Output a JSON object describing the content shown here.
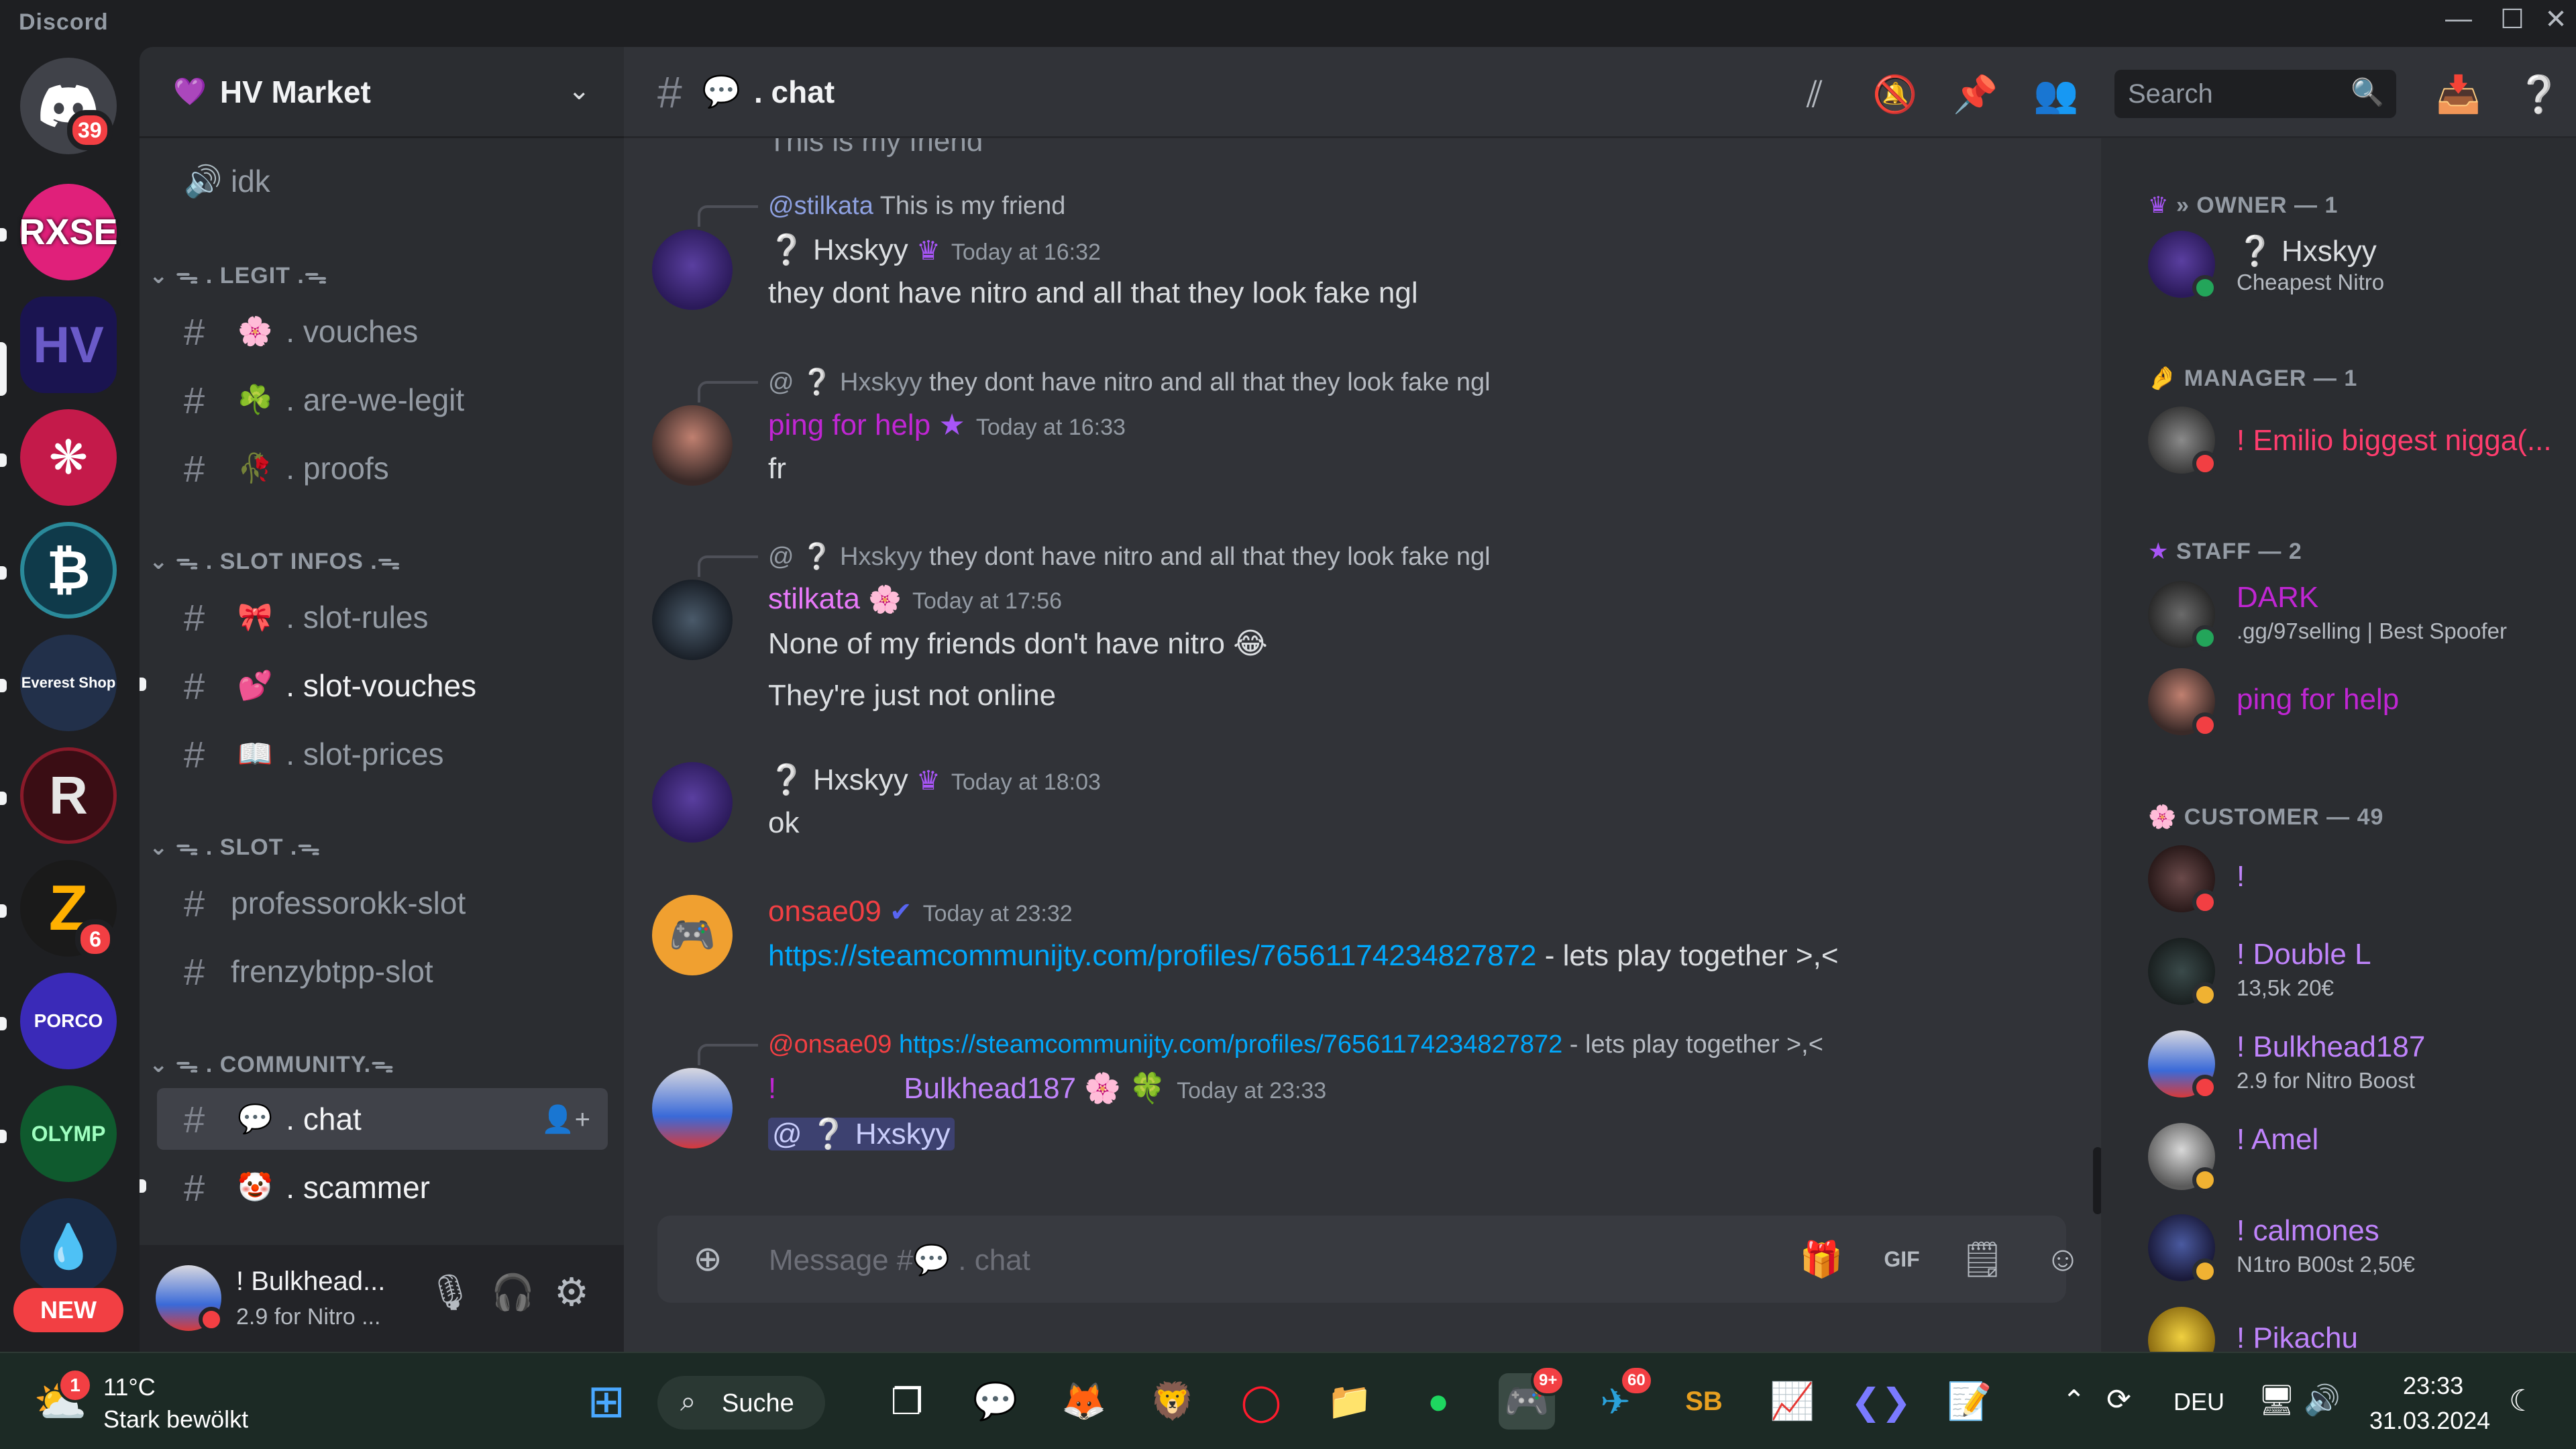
{
  "app": {
    "title": "Discord"
  },
  "window_controls": {
    "minimize": "—",
    "maximize": "☐",
    "close": "✕"
  },
  "rail": {
    "home_badge": "39",
    "servers": [
      {
        "name": "RXSE",
        "label": "RXSE",
        "color": "#e0207a"
      },
      {
        "name": "HV Market",
        "label": "HV",
        "color": "#1a1450"
      },
      {
        "name": "Service",
        "label": "❋",
        "color": "#c41a4a"
      },
      {
        "name": "Bitcoin",
        "label": "₿",
        "color": "#0f3a4a"
      },
      {
        "name": "Everest Shop",
        "label": "Everest Shop",
        "color": "#22304a"
      },
      {
        "name": "R server",
        "label": "R",
        "color": "#3a0d14"
      },
      {
        "name": "Z server",
        "label": "Z",
        "color": "#1a1a1a"
      },
      {
        "name": "Porco Exchange",
        "label": "PORCO",
        "color": "#3a2ab8"
      },
      {
        "name": "Olymp",
        "label": "OLYMP",
        "color": "#0f5a2e"
      },
      {
        "name": "Drop",
        "label": "💧",
        "color": "#1a2a44"
      }
    ],
    "z_badge": "6",
    "new_label": "NEW"
  },
  "guild": {
    "name": "HV Market",
    "icon": "💜"
  },
  "channels": {
    "voice_idk": "idk",
    "categories": [
      {
        "label": "ᯓ . LEGIT .ᯓ"
      },
      {
        "label": "ᯓ . SLOT INFOS .ᯓ"
      },
      {
        "label": "ᯓ . SLOT .ᯓ"
      },
      {
        "label": "ᯓ . COMMUNITY.ᯓ"
      }
    ],
    "items": [
      {
        "emoji": "🌸",
        "label": ". vouches"
      },
      {
        "emoji": "☘️",
        "label": ". are-we-legit"
      },
      {
        "emoji": "🥀",
        "label": ". proofs"
      },
      {
        "emoji": "🎀",
        "label": ". slot-rules"
      },
      {
        "emoji": "💕",
        "label": ". slot-vouches"
      },
      {
        "emoji": "📖",
        "label": ". slot-prices"
      },
      {
        "emoji": "",
        "label": "professorokk-slot"
      },
      {
        "emoji": "",
        "label": "frenzybtpp-slot"
      },
      {
        "emoji": "💬",
        "label": ". chat"
      },
      {
        "emoji": "🤡",
        "label": ". scammer"
      }
    ]
  },
  "user_panel": {
    "name": "! Bulkhead...",
    "status": "2.9 for Nitro ..."
  },
  "chat_header": {
    "channel_name": ". chat",
    "search_placeholder": "Search"
  },
  "messages": {
    "cut_top": "This is my friend",
    "m1": {
      "reply_name": "@stilkata",
      "reply_text": "This is my friend",
      "author": "❔ Hxskyy",
      "ts": "Today at 16:32",
      "text": "they dont have nitro and all that they look fake ngl"
    },
    "m2": {
      "reply_name": "@ ❔ Hxskyy",
      "reply_text": "they dont have nitro and all that they look fake ngl",
      "author": "ping for help",
      "ts": "Today at 16:33",
      "text": "fr"
    },
    "m3": {
      "reply_name": "@ ❔ Hxskyy",
      "reply_text": "they dont have nitro and all that they look fake ngl",
      "author": "stilkata",
      "ts": "Today at 17:56",
      "text": "None of my friends don't have nitro 😂",
      "text2": "They're just not online"
    },
    "m4": {
      "author": "❔ Hxskyy",
      "ts": "Today at 18:03",
      "text": "ok"
    },
    "m5": {
      "author": "onsae09",
      "ts": "Today at 23:32",
      "link": "https://steamcommunijty.com/profiles/76561174234827872",
      "text": " - lets play together >,<"
    },
    "m6": {
      "reply_name": "@onsae09",
      "reply_link": "https://steamcommunijty.com/profiles/76561174234827872",
      "reply_text": " - lets play together >,<",
      "author_prefix": "!",
      "author": "Bulkhead187 🌸 🍀",
      "ts": "Today at 23:33",
      "mention": "@ ❔ Hxskyy"
    }
  },
  "composer": {
    "placeholder": "Message #💬 . chat"
  },
  "member_list": {
    "owner_cat": "» OWNER — 1",
    "owner": {
      "name": "❔ Hxskyy",
      "sub": "Cheapest Nitro"
    },
    "manager_cat": "MANAGER — 1",
    "manager": {
      "name": "! Emilio biggest nigga(..."
    },
    "staff_cat": "STAFF — 2",
    "staff": [
      {
        "name": "DARK",
        "sub": ".gg/97selling | Best Spoofer"
      },
      {
        "name": "ping for help",
        "sub": ""
      }
    ],
    "customer_cat": "CUSTOMER — 49",
    "customers": [
      {
        "name": "!",
        "sub": ""
      },
      {
        "name": "! Double L",
        "sub": "13,5k 20€"
      },
      {
        "name": "! Bulkhead187",
        "sub": "2.9 for Nitro Boost"
      },
      {
        "name": "! Amel",
        "sub": ""
      },
      {
        "name": "! calmones",
        "sub": "N1tro B00st 2,50€"
      },
      {
        "name": "! Pikachu",
        "sub": ""
      }
    ]
  },
  "taskbar": {
    "weather_temp": "11°C",
    "weather_desc": "Stark bewölkt",
    "weather_badge": "1",
    "search_label": "Suche",
    "discord_badge": "9+",
    "telegram_badge": "60",
    "lang": "DEU",
    "time": "23:33",
    "date": "31.03.2024"
  },
  "colors": {
    "accent": "#5865f2",
    "owner": "#dbdee1",
    "staff": "#a855f7",
    "manager": "#ff5c8a",
    "customer": "#c084fc"
  }
}
